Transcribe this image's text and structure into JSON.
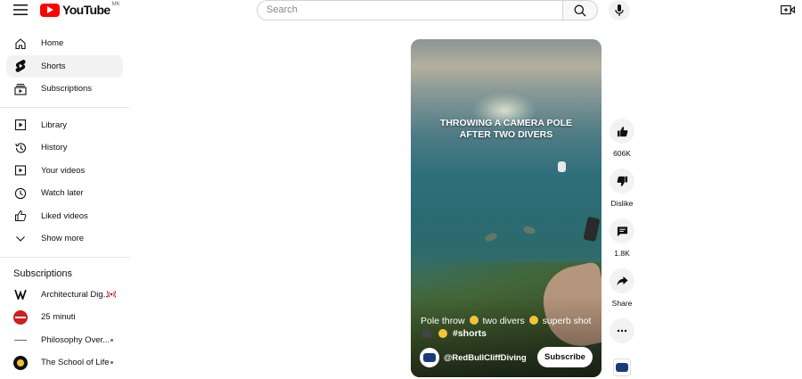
{
  "header": {
    "logo_text": "YouTube",
    "country_code": "MK",
    "search_placeholder": "Search",
    "icons": {
      "menu": "hamburger-icon",
      "search": "search-icon",
      "mic": "microphone-icon",
      "create": "create-video-icon"
    }
  },
  "sidebar": {
    "main": [
      {
        "label": "Home",
        "icon": "home-icon"
      },
      {
        "label": "Shorts",
        "icon": "shorts-icon",
        "active": true
      },
      {
        "label": "Subscriptions",
        "icon": "subscriptions-icon"
      }
    ],
    "library": [
      {
        "label": "Library",
        "icon": "library-icon"
      },
      {
        "label": "History",
        "icon": "history-icon"
      },
      {
        "label": "Your videos",
        "icon": "your-videos-icon"
      },
      {
        "label": "Watch later",
        "icon": "watch-later-icon"
      },
      {
        "label": "Liked videos",
        "icon": "thumbs-up-icon"
      },
      {
        "label": "Show more",
        "icon": "chevron-down-icon"
      }
    ],
    "subscriptions_title": "Subscriptions",
    "subscriptions": [
      {
        "label": "Architectural Dig...",
        "indicator": "live"
      },
      {
        "label": "25 minuti",
        "indicator": "none"
      },
      {
        "label": "Philosophy Over...",
        "indicator": "new"
      },
      {
        "label": "The School of Life",
        "indicator": "new"
      }
    ]
  },
  "short": {
    "overlay_line1": "THROWING A CAMERA POLE",
    "overlay_line2": "AFTER TWO DIVERS",
    "caption_line1_a": "Pole throw",
    "caption_line1_b": "two divers",
    "caption_line1_c": "superb shot",
    "caption_hashtag": "#shorts",
    "channel": "@RedBullCliffDiving",
    "subscribe_label": "Subscribe"
  },
  "actions": {
    "likes": "606K",
    "dislike": "Dislike",
    "comments": "1.8K",
    "share": "Share"
  },
  "colors": {
    "brand_red": "#ff0000",
    "text": "#0f0f0f",
    "active_bg": "#f2f2f2",
    "live_red": "#cc0000",
    "new_dot": "#3a6fd8"
  }
}
